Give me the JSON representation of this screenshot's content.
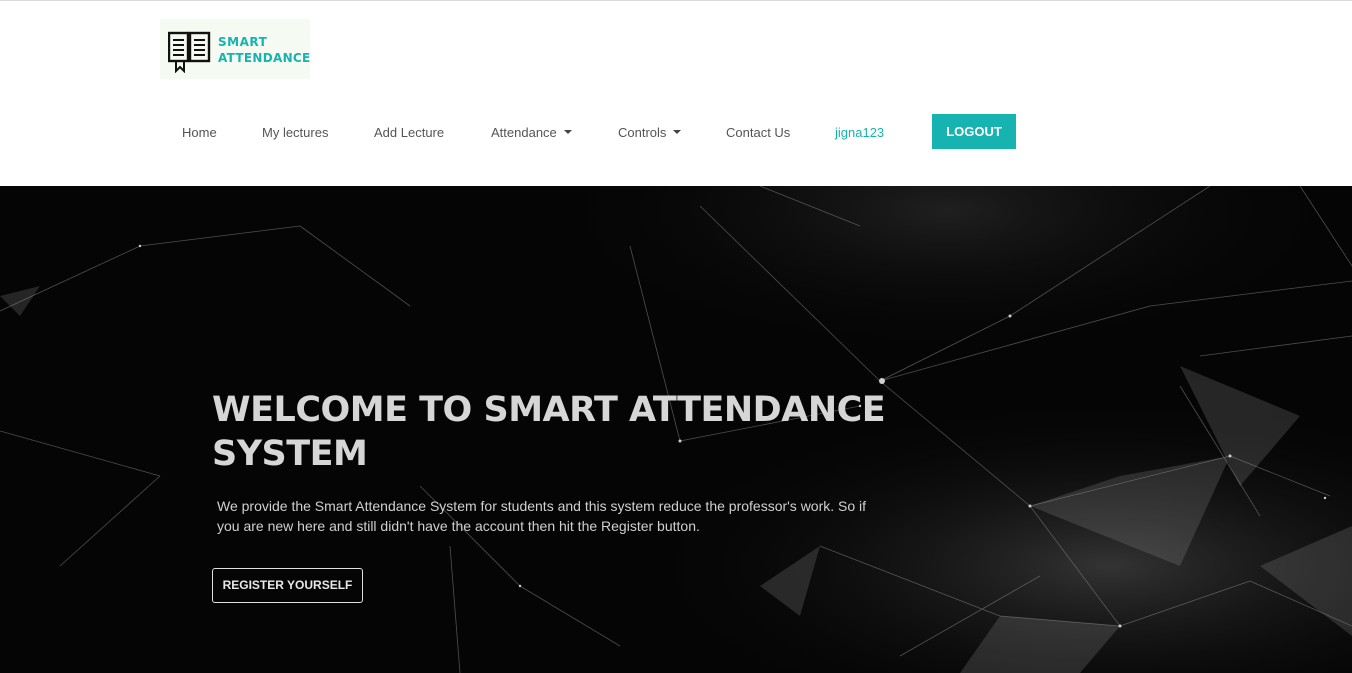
{
  "brand": {
    "line1": "SMART",
    "line2": "ATTENDANCE",
    "icon": "book-icon",
    "color": "#17b3b0"
  },
  "nav": {
    "home": "Home",
    "my_lectures": "My lectures",
    "add_lecture": "Add Lecture",
    "attendance": "Attendance",
    "controls": "Controls",
    "contact": "Contact Us",
    "user": "jigna123",
    "logout": "LOGOUT"
  },
  "hero": {
    "title": "WELCOME TO SMART ATTENDANCE SYSTEM",
    "description": "We provide the Smart Attendance System for students and this system reduce the professor's work. So if you are new here and still didn't have the account then hit the Register button.",
    "register_button": "REGISTER YOURSELF"
  },
  "colors": {
    "accent": "#17b3b0",
    "hero_bg": "#050505"
  }
}
